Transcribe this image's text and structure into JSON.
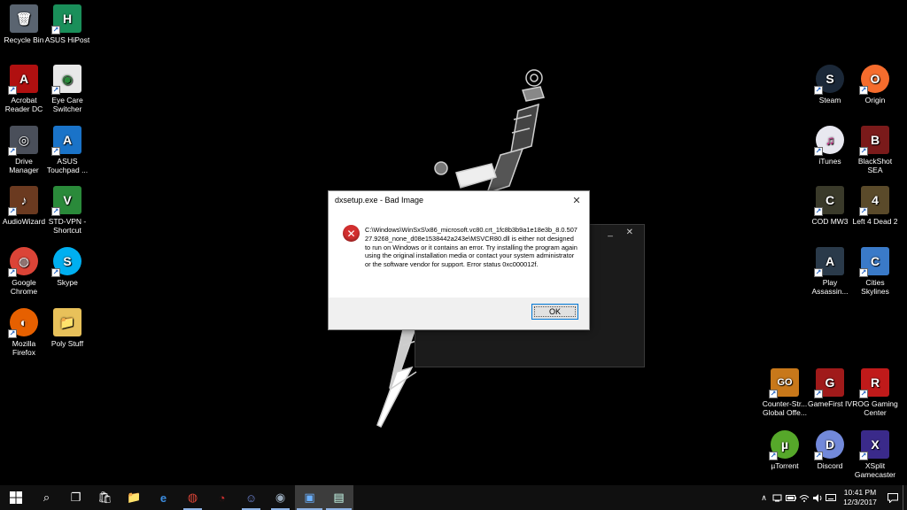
{
  "desktop": {
    "icons": [
      {
        "label": "Recycle Bin",
        "glyph": "🗑",
        "color": "#5a6470"
      },
      {
        "label": "ASUS HiPost",
        "glyph": "H",
        "color": "#1a8f5a"
      },
      {
        "label": "Acrobat Reader DC",
        "glyph": "A",
        "color": "#b01010"
      },
      {
        "label": "Eye Care Switcher",
        "glyph": "◉",
        "color": "#e8e8e8"
      },
      {
        "label": "Drive Manager",
        "glyph": "◎",
        "color": "#4a4f5a"
      },
      {
        "label": "ASUS Touchpad ...",
        "glyph": "A",
        "color": "#1a73c8"
      },
      {
        "label": "AudioWizard",
        "glyph": "♪",
        "color": "#6b3a20"
      },
      {
        "label": "STD-VPN - Shortcut",
        "glyph": "V",
        "color": "#2a8a3a"
      },
      {
        "label": "Google Chrome",
        "glyph": "◍",
        "color": "#db4437"
      },
      {
        "label": "Skype",
        "glyph": "S",
        "color": "#00aff0"
      },
      {
        "label": "Mozilla Firefox",
        "glyph": "◐",
        "color": "#e66000"
      },
      {
        "label": "Poly Stuff",
        "glyph": "📁",
        "color": "#e8c15a"
      },
      {
        "label": "Steam",
        "glyph": "S",
        "color": "#1b2838"
      },
      {
        "label": "Origin",
        "glyph": "O",
        "color": "#f56c2d"
      },
      {
        "label": "iTunes",
        "glyph": "♫",
        "color": "#e8e8f0"
      },
      {
        "label": "BlackShot SEA",
        "glyph": "B",
        "color": "#7a1a1a"
      },
      {
        "label": "COD MW3",
        "glyph": "C",
        "color": "#3a3a2a"
      },
      {
        "label": "Left 4 Dead 2",
        "glyph": "4",
        "color": "#5a4a2a"
      },
      {
        "label": "Play Assassin...",
        "glyph": "A",
        "color": "#2a3a4a"
      },
      {
        "label": "Cities Skylines",
        "glyph": "C",
        "color": "#3a7ac8"
      },
      {
        "label": "Counter-Str... Global Offe...",
        "glyph": "GO",
        "color": "#c8781a"
      },
      {
        "label": "GameFirst IV",
        "glyph": "G",
        "color": "#a01a1a"
      },
      {
        "label": "ROG Gaming Center",
        "glyph": "R",
        "color": "#c01a1a"
      },
      {
        "label": "µTorrent",
        "glyph": "µ",
        "color": "#56a82a"
      },
      {
        "label": "Discord",
        "glyph": "D",
        "color": "#7289da"
      },
      {
        "label": "XSplit Gamecaster",
        "glyph": "X",
        "color": "#3a2a8a"
      }
    ]
  },
  "background_window": {
    "controls": "_ ✕"
  },
  "dialog": {
    "title": "dxsetup.exe - Bad Image",
    "close_glyph": "✕",
    "message": "C:\\Windows\\WinSxS\\x86_microsoft.vc80.crt_1fc8b3b9a1e18e3b_8.0.50727.9268_none_d08e1538442a243e\\MSVCR80.dll is either not designed to run on Windows or it contains an error. Try installing the program again using the original installation media or contact your system administrator or the software vendor for support. Error status 0xc000012f.",
    "ok_label": "OK"
  },
  "taskbar": {
    "start_icon": "windows-icon",
    "items": [
      {
        "name": "search-icon",
        "glyph": "⌕"
      },
      {
        "name": "task-view-icon",
        "glyph": "❐"
      },
      {
        "name": "store-icon",
        "glyph": "🛍"
      },
      {
        "name": "file-explorer-icon",
        "glyph": "📁"
      },
      {
        "name": "edge-icon",
        "glyph": "e"
      },
      {
        "name": "chrome-icon",
        "glyph": "◍"
      },
      {
        "name": "gamefirst-icon",
        "glyph": "◔"
      },
      {
        "name": "discord-icon",
        "glyph": "☺"
      },
      {
        "name": "steam-icon",
        "glyph": "◉"
      },
      {
        "name": "dxsetup-icon",
        "glyph": "▣"
      },
      {
        "name": "dialog-app-icon",
        "glyph": "▤"
      }
    ],
    "tray": {
      "chevron": "∧",
      "clock_time": "10:41 PM",
      "clock_date": "12/3/2017"
    }
  }
}
